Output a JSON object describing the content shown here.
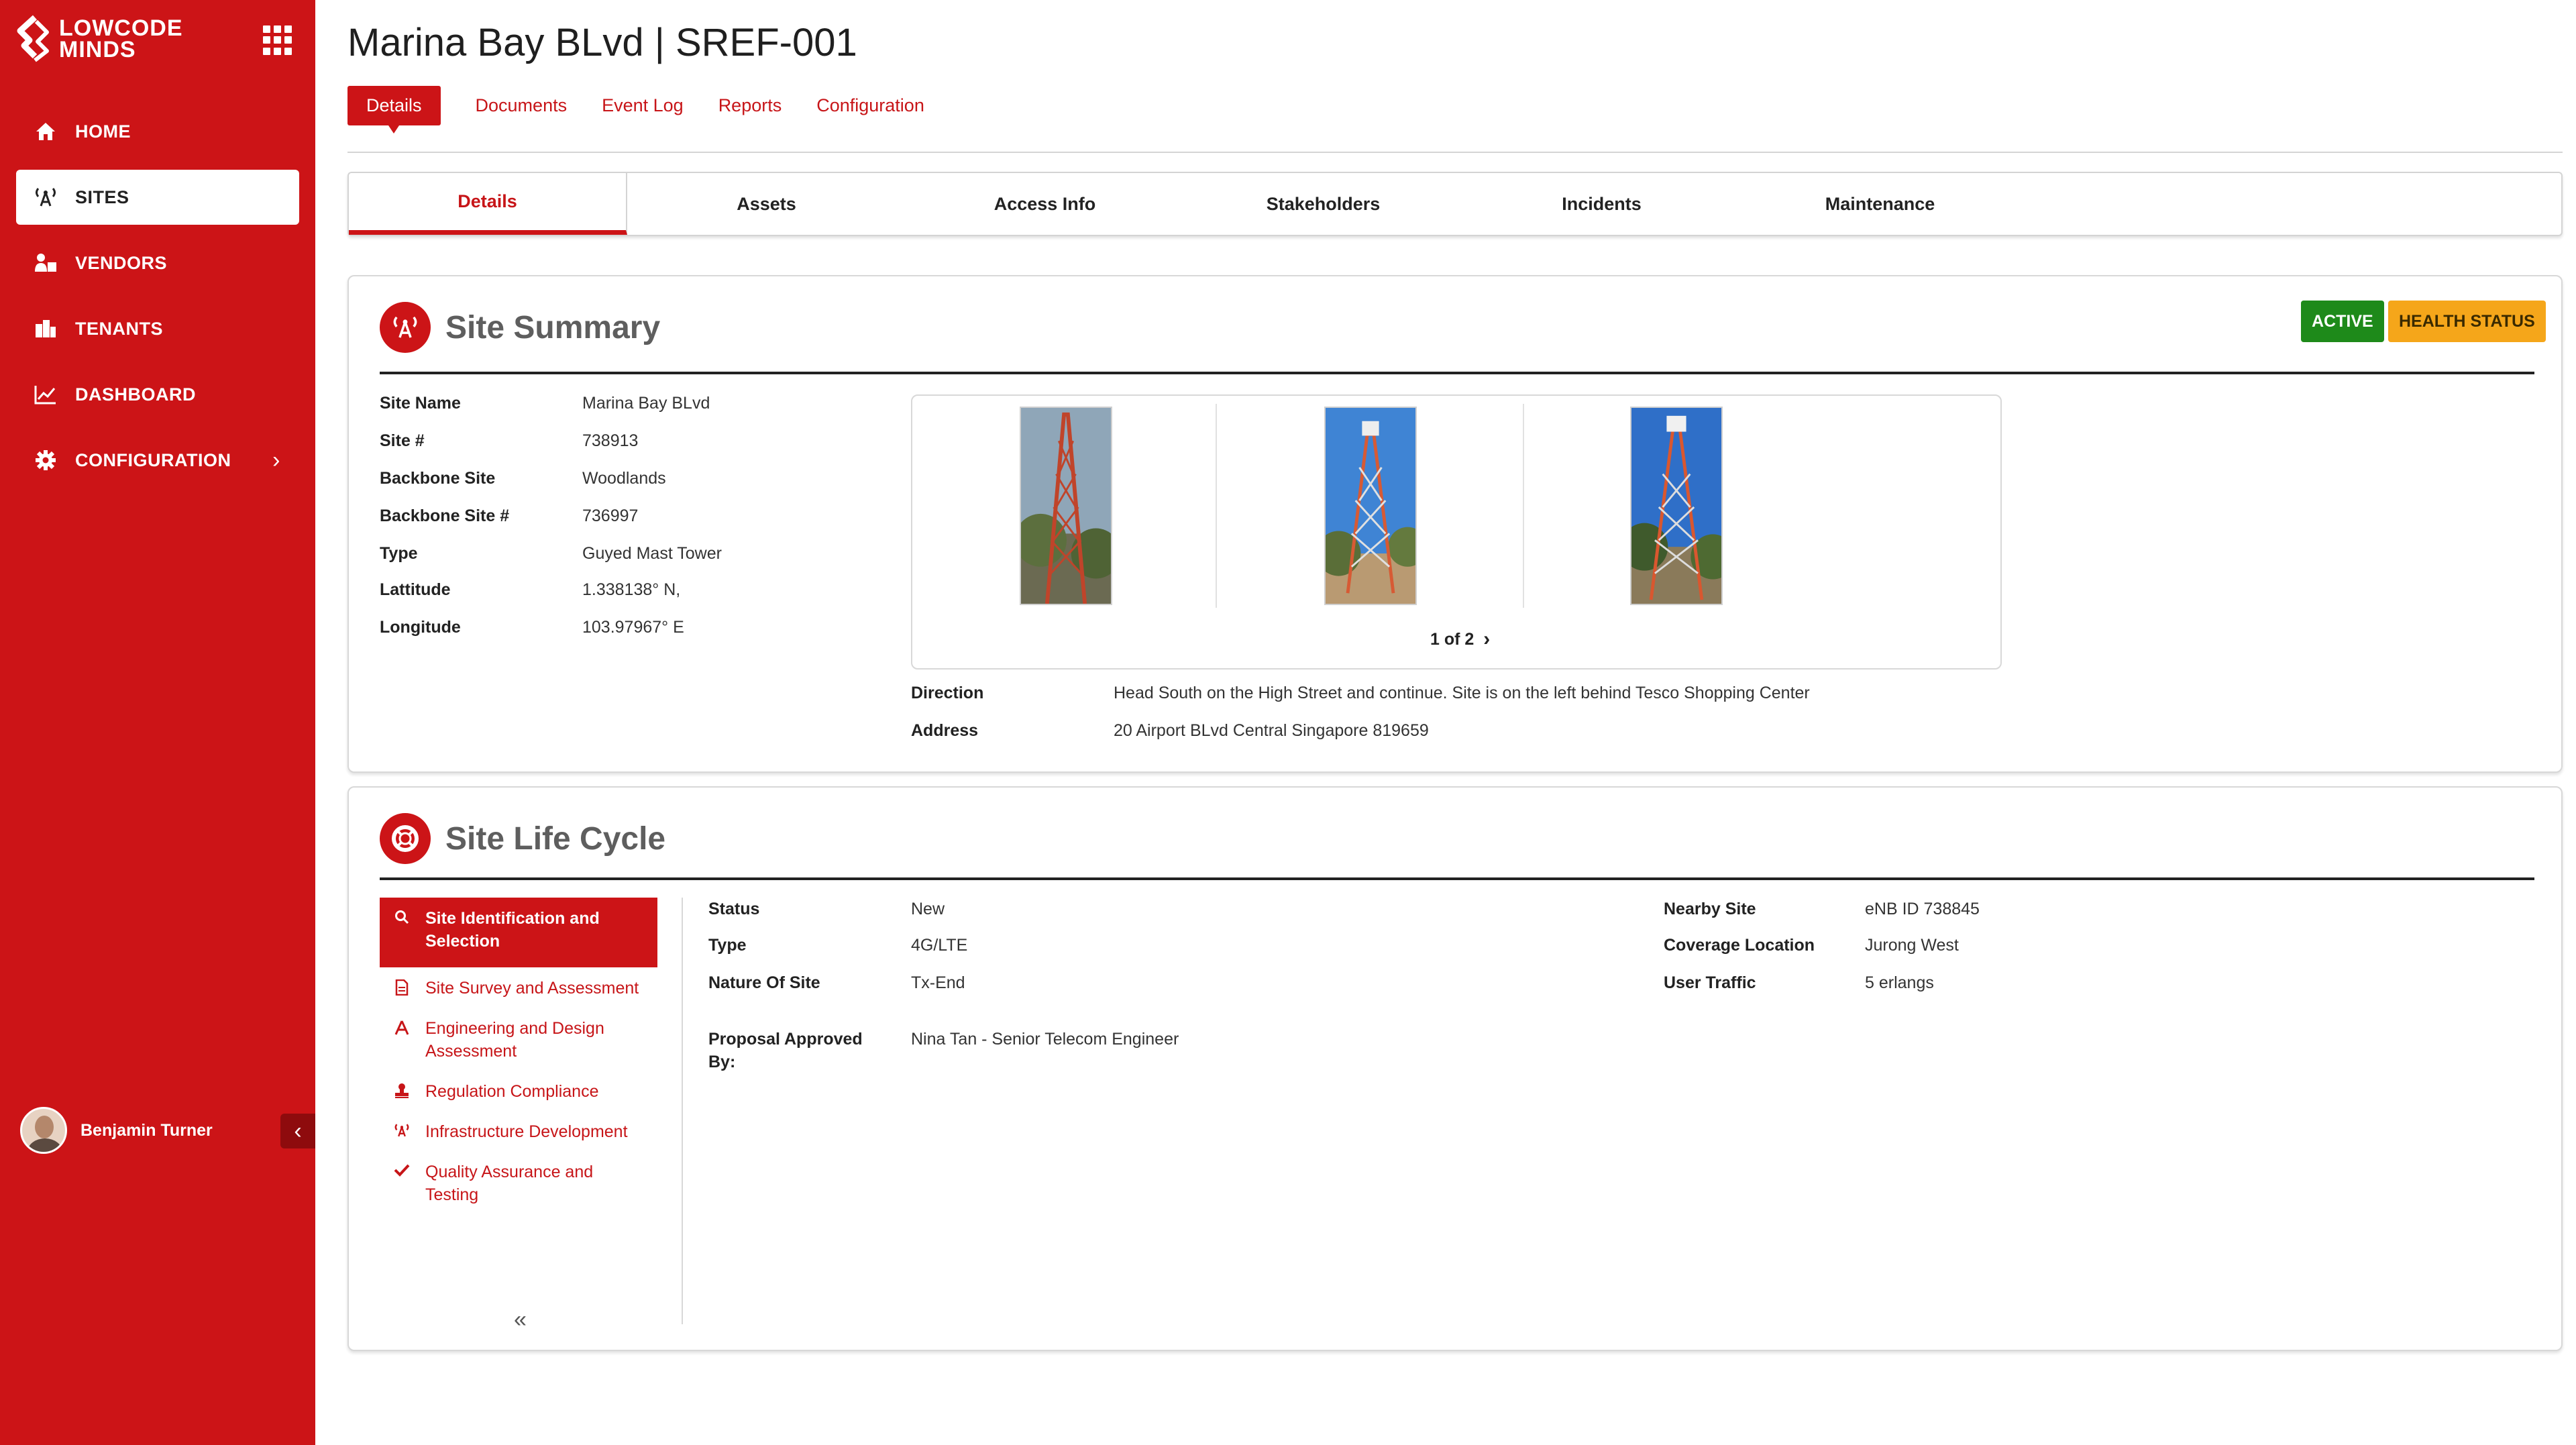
{
  "brand": {
    "line1": "LOWCODE",
    "line2": "MINDS"
  },
  "sidebar": {
    "items": [
      {
        "label": "HOME",
        "icon": "home-icon"
      },
      {
        "label": "SITES",
        "icon": "antenna-icon",
        "active": true
      },
      {
        "label": "VENDORS",
        "icon": "vendors-icon"
      },
      {
        "label": "TENANTS",
        "icon": "building-icon"
      },
      {
        "label": "DASHBOARD",
        "icon": "chart-line-icon"
      },
      {
        "label": "CONFIGURATION",
        "icon": "gear-icon",
        "has_submenu": true
      }
    ],
    "user": {
      "name": "Benjamin Turner"
    }
  },
  "header": {
    "title": "Marina Bay BLvd | SREF-001",
    "tabs": [
      "Details",
      "Documents",
      "Event Log",
      "Reports",
      "Configuration"
    ],
    "active_tab": "Details"
  },
  "subtabs": {
    "items": [
      "Details",
      "Assets",
      "Access Info",
      "Stakeholders",
      "Incidents",
      "Maintenance"
    ],
    "active": "Details"
  },
  "site_summary": {
    "title": "Site Summary",
    "badges": {
      "active": "ACTIVE",
      "health": "HEALTH STATUS"
    },
    "fields": [
      {
        "label": "Site Name",
        "value": "Marina Bay BLvd"
      },
      {
        "label": "Site #",
        "value": "738913"
      },
      {
        "label": "Backbone Site",
        "value": "Woodlands"
      },
      {
        "label": "Backbone Site #",
        "value": "736997"
      },
      {
        "label": "Type",
        "value": "Guyed Mast Tower"
      },
      {
        "label": "Lattitude",
        "value": "1.338138° N,"
      },
      {
        "label": "Longitude",
        "value": "103.97967° E"
      }
    ],
    "gallery": {
      "pager": "1 of 2",
      "next": "›"
    },
    "direction": {
      "label": "Direction",
      "value": "Head South on the High Street and continue. Site is on the left behind Tesco Shopping Center"
    },
    "address": {
      "label": "Address",
      "value": "20 Airport BLvd Central Singapore 819659"
    }
  },
  "life_cycle": {
    "title": "Site Life Cycle",
    "steps": [
      {
        "label": "Site Identification and Selection",
        "icon": "search-icon",
        "active": true
      },
      {
        "label": "Site Survey and Assessment",
        "icon": "document-icon"
      },
      {
        "label": "Engineering and Design Assessment",
        "icon": "compass-icon"
      },
      {
        "label": "Regulation Compliance",
        "icon": "stamp-icon"
      },
      {
        "label": "Infrastructure Development",
        "icon": "antenna-icon"
      },
      {
        "label": "Quality Assurance and Testing",
        "icon": "check-icon"
      }
    ],
    "collapse": "«",
    "left_fields": [
      {
        "label": "Status",
        "value": "New"
      },
      {
        "label": "Type",
        "value": "4G/LTE"
      },
      {
        "label": "Nature Of Site",
        "value": "Tx-End"
      }
    ],
    "proposal": {
      "label_line1": "Proposal Approved",
      "label_line2": "By:",
      "value": "Nina Tan - Senior Telecom Engineer"
    },
    "right_fields": [
      {
        "label": "Nearby Site",
        "value": "eNB ID 738845"
      },
      {
        "label": "Coverage Location",
        "value": "Jurong West"
      },
      {
        "label": "User Traffic",
        "value": "5 erlangs"
      }
    ]
  },
  "colors": {
    "brand_red": "#cc1417",
    "active_green": "#1e8a1a",
    "health_orange": "#f5a61a"
  }
}
